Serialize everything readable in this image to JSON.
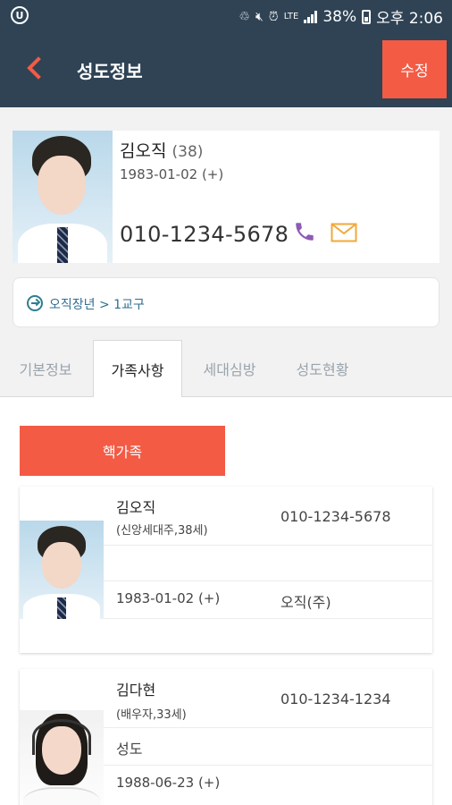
{
  "status_bar": {
    "battery": "38%",
    "time": "오후 2:06",
    "network": "LTE"
  },
  "header": {
    "title": "성도정보",
    "edit_label": "수정"
  },
  "profile": {
    "name": "김오직",
    "age": "(38)",
    "birth": "1983-01-02 (+)",
    "phone": "010-1234-5678"
  },
  "group": {
    "path": "오직장년 > 1교구"
  },
  "tabs": [
    {
      "label": "기본정보",
      "active": false
    },
    {
      "label": "가족사항",
      "active": true
    },
    {
      "label": "세대심방",
      "active": false
    },
    {
      "label": "성도현황",
      "active": false
    }
  ],
  "family": {
    "section_label": "핵가족",
    "members": [
      {
        "name": "김오직",
        "relation": "(신앙세대주,38세)",
        "phone": "010-1234-5678",
        "role": "",
        "birth": "1983-01-02 (+)",
        "title": "오직(주)"
      },
      {
        "name": "김다현",
        "relation": "(배우자,33세)",
        "phone": "010-1234-1234",
        "role": "성도",
        "birth": "1988-06-23 (+)",
        "title": ""
      }
    ]
  },
  "colors": {
    "header_bg": "#2f4355",
    "accent": "#f35b45",
    "call_icon": "#8e5bb5",
    "mail_icon": "#f2a93b"
  }
}
